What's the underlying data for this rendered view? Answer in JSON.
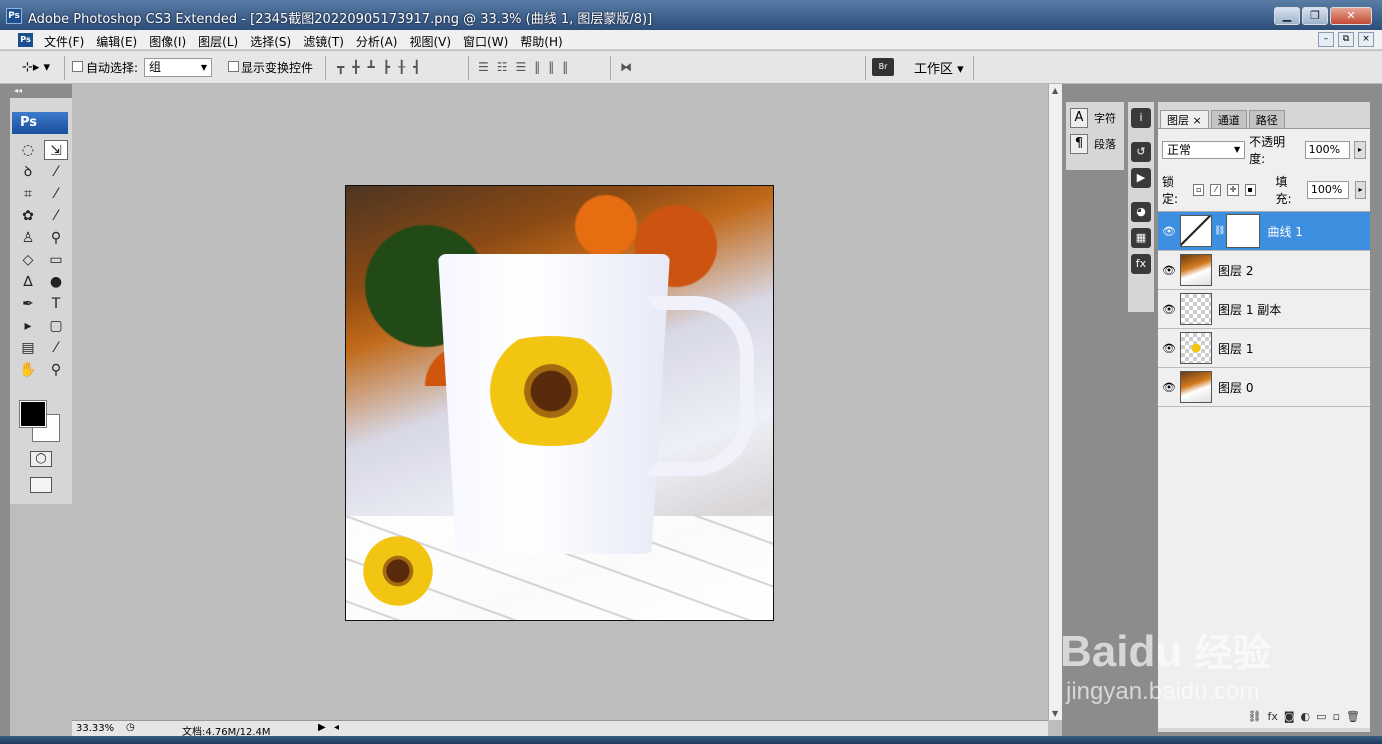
{
  "window": {
    "app_logo": "Ps",
    "title": "Adobe Photoshop CS3 Extended - [2345截图20220905173917.png @ 33.3% (曲线 1, 图层蒙版/8)]",
    "controls": [
      "▁",
      "❐",
      "✕"
    ]
  },
  "menubar": {
    "items": [
      "文件(F)",
      "编辑(E)",
      "图像(I)",
      "图层(L)",
      "选择(S)",
      "滤镜(T)",
      "分析(A)",
      "视图(V)",
      "窗口(W)",
      "帮助(H)"
    ],
    "doc_controls": [
      "–",
      "⧉",
      "×"
    ]
  },
  "options": {
    "auto_select_label": "自动选择:",
    "auto_select_value": "组",
    "show_transform_label": "显示变换控件",
    "workspace_label": "工作区 ▾"
  },
  "toolbox": {
    "logo": "Ps"
  },
  "statusbar": {
    "zoom": "33.33%",
    "doc_info": "文档:4.76M/12.4M"
  },
  "char_panel": {
    "character_label": "字符",
    "paragraph_label": "段落"
  },
  "layers_panel": {
    "tabs": [
      "图层",
      "通道",
      "路径"
    ],
    "blend_mode": "正常",
    "opacity_label": "不透明度:",
    "opacity_value": "100%",
    "lock_label": "锁定:",
    "fill_label": "填充:",
    "fill_value": "100%",
    "layers": [
      {
        "name": "曲线 1",
        "selected": true,
        "thumb": "curves"
      },
      {
        "name": "图层 2",
        "selected": false,
        "thumb": "photo"
      },
      {
        "name": "图层 1 副本",
        "selected": false,
        "thumb": "trans"
      },
      {
        "name": "图层 1",
        "selected": false,
        "thumb": "trans2"
      },
      {
        "name": "图层 0",
        "selected": false,
        "thumb": "photo"
      }
    ]
  },
  "watermark": {
    "brand": "Bai",
    "brand_du": "du",
    "brand_cn": "经验",
    "url": "jingyan.baidu.com"
  }
}
